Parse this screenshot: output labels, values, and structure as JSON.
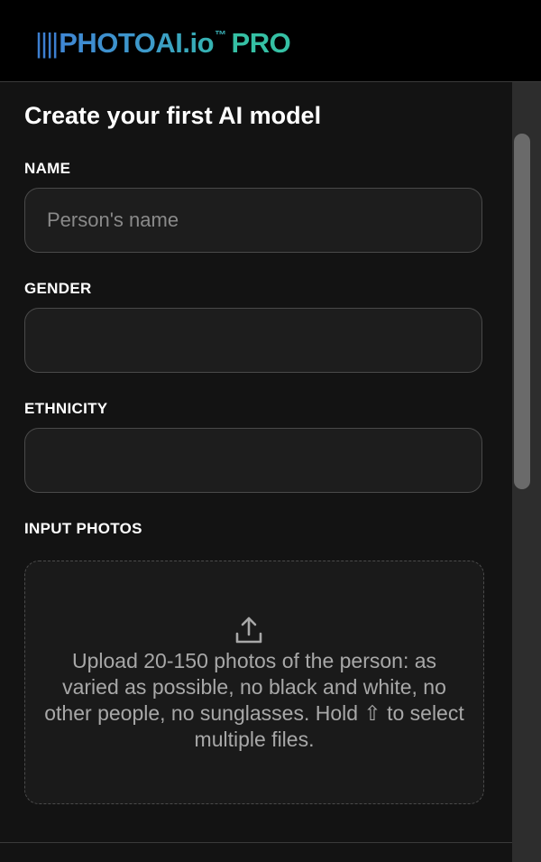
{
  "header": {
    "logo_bars": "||||",
    "logo_name": "PHOTOAI.io",
    "logo_tm": "™",
    "logo_pro": "PRO"
  },
  "form": {
    "title": "Create your first AI model",
    "name": {
      "label": "NAME",
      "placeholder": "Person's name",
      "value": ""
    },
    "gender": {
      "label": "GENDER",
      "value": ""
    },
    "ethnicity": {
      "label": "ETHNICITY",
      "value": ""
    },
    "input_photos": {
      "label": "INPUT PHOTOS",
      "dropzone_text": "Upload 20-150 photos of the person: as varied as possible, no black and white, no other people, no sunglasses. Hold ⇧ to select multiple files.",
      "icon": "upload-icon"
    }
  },
  "colors": {
    "background": "#131313",
    "header_bg": "#000000",
    "field_bg": "#1d1d1d",
    "field_border": "#4a4a4a",
    "logo_blue": "#3f86d4",
    "logo_teal": "#35c0a4"
  }
}
